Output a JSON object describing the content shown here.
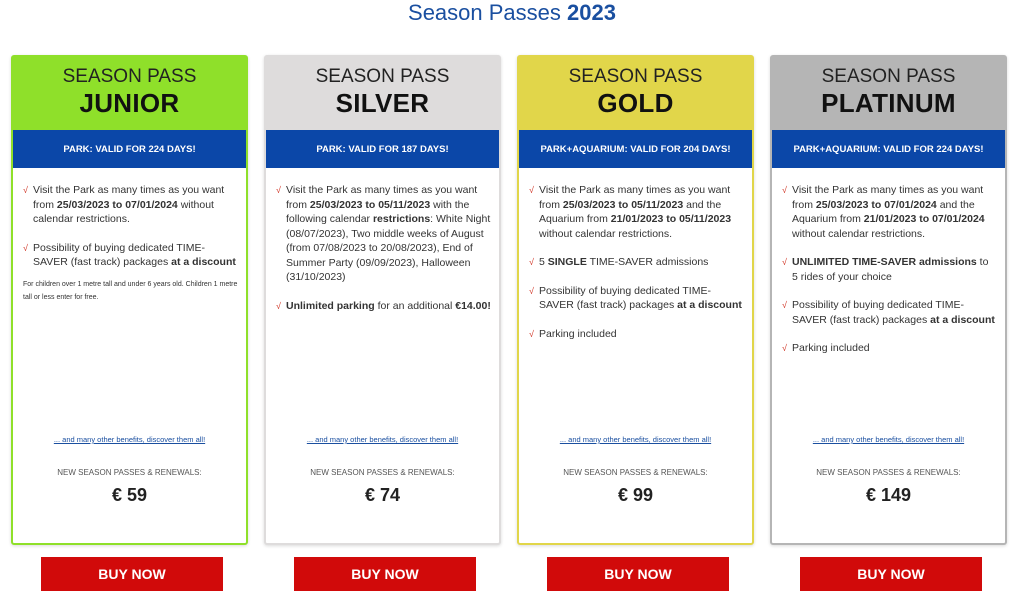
{
  "page_title": {
    "text": "Season Passes",
    "year": "2023"
  },
  "colors": {
    "junior": "#8fe02a",
    "silver": "#dedcdc",
    "gold": "#e1d64a",
    "platinum": "#b5b5b5",
    "valid_bar": "#0b47a8",
    "buy_button": "#d10a0a",
    "check": "#d23a2b",
    "title": "#1a4fa0"
  },
  "icons": {
    "check": "check-icon"
  },
  "check_glyph": "√",
  "cards": [
    {
      "pass_line": "SEASON PASS",
      "name": "JUNIOR",
      "validity": "PARK: VALID FOR 224 DAYS!",
      "features": [
        {
          "t1": "Visit the Park as many times as you want from ",
          "b1": "25/03/2023 to 07/01/2024",
          "t2": " without calendar restrictions.",
          "b2": "",
          "t3": ""
        },
        {
          "t1": "Possibility of buying dedicated TIME-SAVER (fast track) packages ",
          "b1": "at a discount",
          "t2": "",
          "b2": "",
          "t3": ""
        }
      ],
      "note": "For children over 1 metre tall and under 6 years old. Children 1 metre tall or less enter for free.",
      "benefits_link": "... and many other benefits, discover them all!",
      "new_label": "NEW SEASON PASSES & RENEWALS:",
      "price": "€ 59",
      "buy_label": "BUY NOW"
    },
    {
      "pass_line": "SEASON PASS",
      "name": "SILVER",
      "validity": "PARK: VALID FOR 187 DAYS!",
      "features": [
        {
          "t1": "Visit the Park as many times as you want from ",
          "b1": "25/03/2023 to 05/11/2023",
          "t2": " with the following calendar ",
          "b2": "restrictions",
          "t3": ": White Night (08/07/2023), Two middle weeks of August (from 07/08/2023 to 20/08/2023), End of Summer Party (09/09/2023), Halloween (31/10/2023)"
        },
        {
          "t1": "",
          "b1": "Unlimited parking",
          "t2": " for an additional ",
          "b2": "€14.00!",
          "t3": ""
        }
      ],
      "note": "",
      "benefits_link": "... and many other benefits, discover them all!",
      "new_label": "NEW SEASON PASSES & RENEWALS:",
      "price": "€ 74",
      "buy_label": "BUY NOW"
    },
    {
      "pass_line": "SEASON PASS",
      "name": "GOLD",
      "validity": "PARK+AQUARIUM: VALID FOR 204 DAYS!",
      "features": [
        {
          "t1": "Visit the Park as many times as you want from ",
          "b1": "25/03/2023 to 05/11/2023",
          "t2": " and the Aquarium from ",
          "b2": "21/01/2023 to 05/11/2023",
          "t3": " without calendar restrictions."
        },
        {
          "t1": "5 ",
          "b1": "SINGLE",
          "t2": " TIME-SAVER admissions",
          "b2": "",
          "t3": ""
        },
        {
          "t1": "Possibility of buying dedicated TIME-SAVER (fast track) packages ",
          "b1": "at a discount",
          "t2": "",
          "b2": "",
          "t3": ""
        },
        {
          "t1": "Parking included",
          "b1": "",
          "t2": "",
          "b2": "",
          "t3": ""
        }
      ],
      "note": "",
      "benefits_link": "... and many other benefits, discover them all!",
      "new_label": "NEW SEASON PASSES & RENEWALS:",
      "price": "€ 99",
      "buy_label": "BUY NOW"
    },
    {
      "pass_line": "SEASON PASS",
      "name": "PLATINUM",
      "validity": "PARK+AQUARIUM: VALID FOR 224 DAYS!",
      "features": [
        {
          "t1": "Visit the Park as many times as you want from ",
          "b1": "25/03/2023 to 07/01/2024",
          "t2": " and the Aquarium from ",
          "b2": "21/01/2023 to 07/01/2024",
          "t3": " without calendar restrictions."
        },
        {
          "t1": "",
          "b1": "UNLIMITED TIME-SAVER admissions",
          "t2": " to 5 rides of your choice",
          "b2": "",
          "t3": ""
        },
        {
          "t1": "Possibility of buying dedicated TIME-SAVER (fast track) packages ",
          "b1": "at a discount",
          "t2": "",
          "b2": "",
          "t3": ""
        },
        {
          "t1": "Parking included",
          "b1": "",
          "t2": "",
          "b2": "",
          "t3": ""
        }
      ],
      "note": "",
      "benefits_link": "... and many other benefits, discover them all!",
      "new_label": "NEW SEASON PASSES & RENEWALS:",
      "price": "€ 149",
      "buy_label": "BUY NOW"
    }
  ]
}
